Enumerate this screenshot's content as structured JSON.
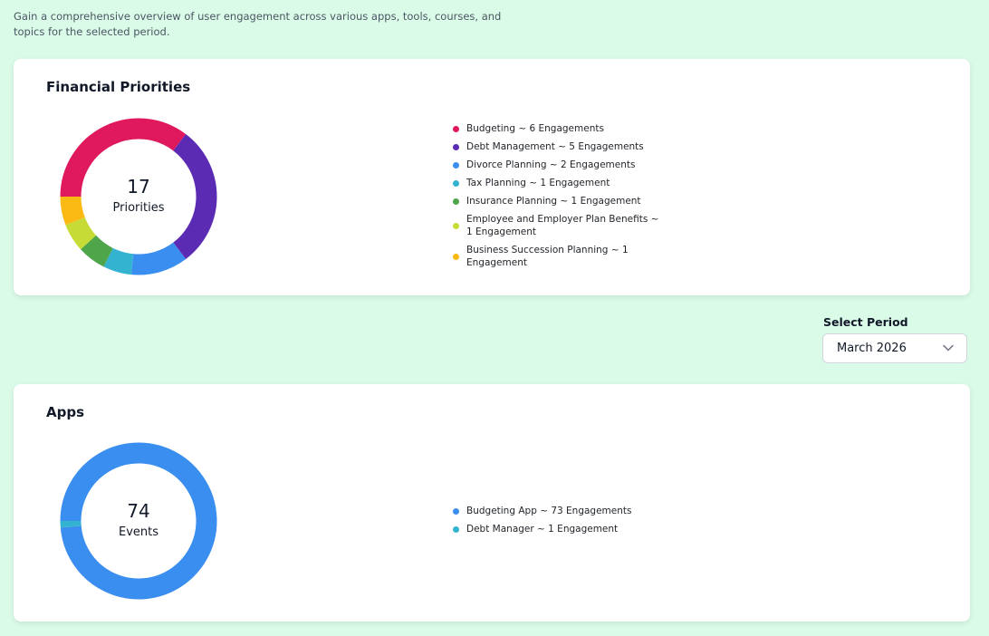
{
  "intro": "Gain a comprehensive overview of user engagement across various apps, tools, courses, and topics for the selected period.",
  "financial_priorities": {
    "title": "Financial Priorities",
    "total": "17",
    "total_label": "Priorities",
    "items": [
      {
        "label": "Budgeting ~ 6 Engagements",
        "value": 6,
        "color": "#e0195e"
      },
      {
        "label": "Debt Management ~ 5 Engagements",
        "value": 5,
        "color": "#5b2bb3"
      },
      {
        "label": "Divorce Planning ~ 2 Engagements",
        "value": 2,
        "color": "#3a8ef0"
      },
      {
        "label": "Tax Planning ~ 1 Engagement",
        "value": 1,
        "color": "#34b3d1"
      },
      {
        "label": "Insurance Planning ~ 1 Engagement",
        "value": 1,
        "color": "#4ea54a"
      },
      {
        "label": "Employee and Employer Plan Benefits ~ 1 Engagement",
        "value": 1,
        "color": "#c6db35"
      },
      {
        "label": "Business Succession Planning ~ 1 Engagement",
        "value": 1,
        "color": "#fbb914"
      }
    ]
  },
  "period": {
    "label": "Select Period",
    "selected": "March 2026"
  },
  "apps": {
    "title": "Apps",
    "total": "74",
    "total_label": "Events",
    "items": [
      {
        "label": "Budgeting App ~ 73 Engagements",
        "value": 73,
        "color": "#3a8ef0"
      },
      {
        "label": "Debt Manager ~ 1 Engagement",
        "value": 1,
        "color": "#34b3d1"
      }
    ]
  }
}
